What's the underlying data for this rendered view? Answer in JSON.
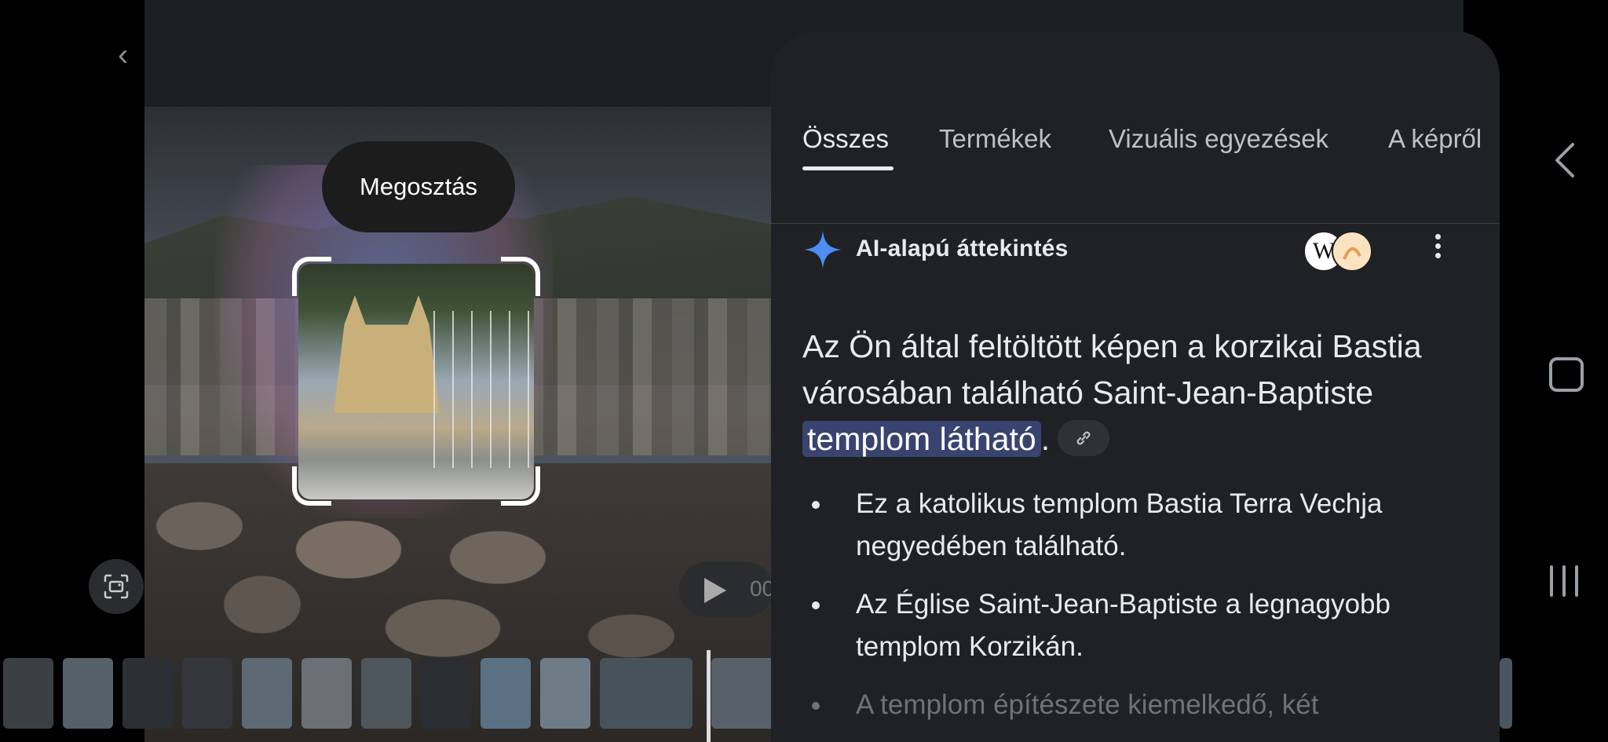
{
  "share": {
    "label": "Megosztás"
  },
  "video": {
    "time_text": "00"
  },
  "tabs": [
    {
      "label": "Összes"
    },
    {
      "label": "Termékek"
    },
    {
      "label": "Vizuális egyezések"
    },
    {
      "label": "A képről"
    }
  ],
  "ai_overview": {
    "title": "AI-alapú áttekintés",
    "sources": [
      "W",
      ""
    ],
    "summary_before": "Az Ön által feltöltött képen a korzikai Bastia városában található Saint-Jean-Baptiste ",
    "summary_highlight": "templom látható",
    "summary_after": ".",
    "bullets": [
      "Ez a katolikus templom Bastia Terra Vechja negyedében található.",
      "Az Église Saint-Jean-Baptiste a legnagyobb templom Korzikán.",
      "A templom építészete kiemelkedő, két"
    ]
  },
  "colors": {
    "panel_bg": "#202124",
    "highlight": "#394370",
    "accent_star": "#4c8df6"
  }
}
